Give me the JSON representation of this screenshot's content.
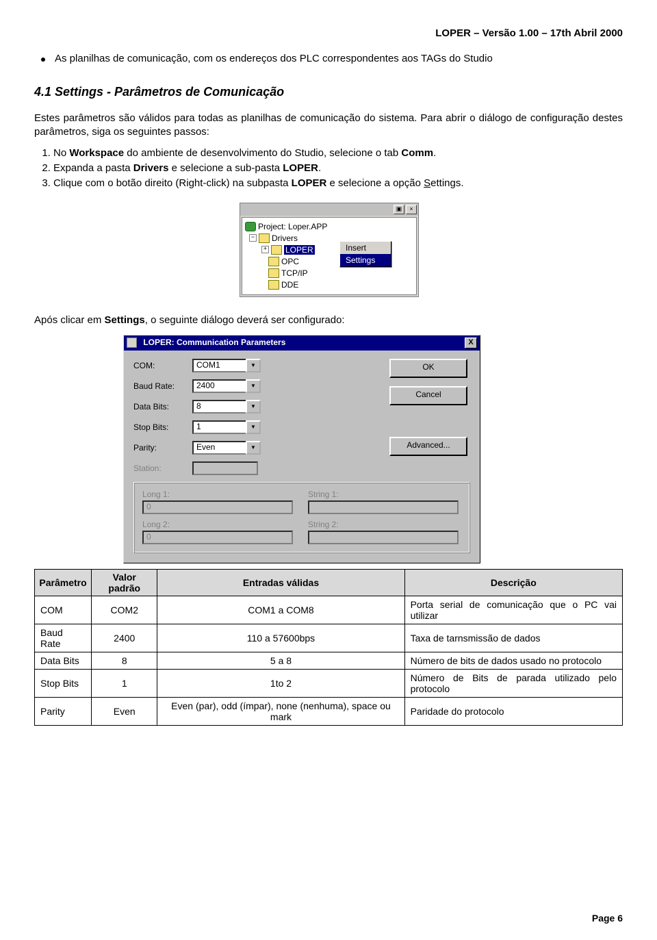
{
  "header": "LOPER – Versão 1.00 – 17th Abril 2000",
  "bullet1": "As planilhas de comunicação, com os endereços dos PLC correspondentes aos TAGs do Studio",
  "section_title": "4.1   Settings - Parâmetros de Comunicação",
  "para1": "Estes parâmetros são válidos para todas as planilhas de comunicação do sistema. Para abrir o diálogo de configuração destes parâmetros, siga os seguintes passos:",
  "steps": {
    "s1a": "No ",
    "s1b": "Workspace",
    "s1c": " do ambiente de desenvolvimento do Studio, selecione o tab ",
    "s1d": "Comm",
    "s1e": ".",
    "s2a": "Expanda a pasta ",
    "s2b": "Drivers",
    "s2c": " e selecione a sub-pasta ",
    "s2d": "LOPER",
    "s2e": ".",
    "s3a": "Clique com o botão direito (Right-click) na subpasta ",
    "s3b": "LOPER",
    "s3c": " e selecione a opção ",
    "s3d": "S",
    "s3e": "ettings."
  },
  "workspace": {
    "project": "Project: Loper.APP",
    "drivers": "Drivers",
    "loper": "LOPER",
    "opc": "OPC",
    "tcpip": "TCP/IP",
    "dde": "DDE",
    "ctx_insert": "Insert",
    "ctx_settings": "Settings"
  },
  "para2a": "Após clicar em ",
  "para2b": "Settings",
  "para2c": ", o seguinte diálogo deverá ser configurado:",
  "dialog": {
    "title": "LOPER: Communication Parameters",
    "labels": {
      "com": "COM:",
      "baud": "Baud Rate:",
      "databits": "Data Bits:",
      "stopbits": "Stop Bits:",
      "parity": "Parity:",
      "station": "Station:",
      "long1": "Long 1:",
      "long2": "Long 2:",
      "string1": "String 1:",
      "string2": "String 2:"
    },
    "values": {
      "com": "COM1",
      "baud": "2400",
      "databits": "8",
      "stopbits": "1",
      "parity": "Even",
      "long1": "0",
      "long2": "0",
      "string1": "",
      "string2": ""
    },
    "buttons": {
      "ok": "OK",
      "cancel": "Cancel",
      "advanced": "Advanced..."
    },
    "close": "X"
  },
  "table": {
    "headers": {
      "param": "Parâmetro",
      "default": "Valor padrão",
      "valid": "Entradas válidas",
      "desc": "Descrição"
    },
    "rows": [
      {
        "param": "COM",
        "default": "COM2",
        "valid": "COM1 a COM8",
        "desc": "Porta serial de comunicação que o PC vai utilizar"
      },
      {
        "param": "Baud Rate",
        "default": "2400",
        "valid": "110 a 57600bps",
        "desc": "Taxa de tarnsmissão de dados"
      },
      {
        "param": "Data Bits",
        "default": "8",
        "valid": "5 a 8",
        "desc": "Número de bits de dados usado no protocolo"
      },
      {
        "param": "Stop Bits",
        "default": "1",
        "valid": "1to 2",
        "desc": "Número de Bits de parada utilizado pelo protocolo"
      },
      {
        "param": "Parity",
        "default": "Even",
        "valid": "Even (par), odd (ímpar), none (nenhuma), space ou mark",
        "desc": "Paridade do protocolo"
      }
    ]
  },
  "footer": "Page 6"
}
